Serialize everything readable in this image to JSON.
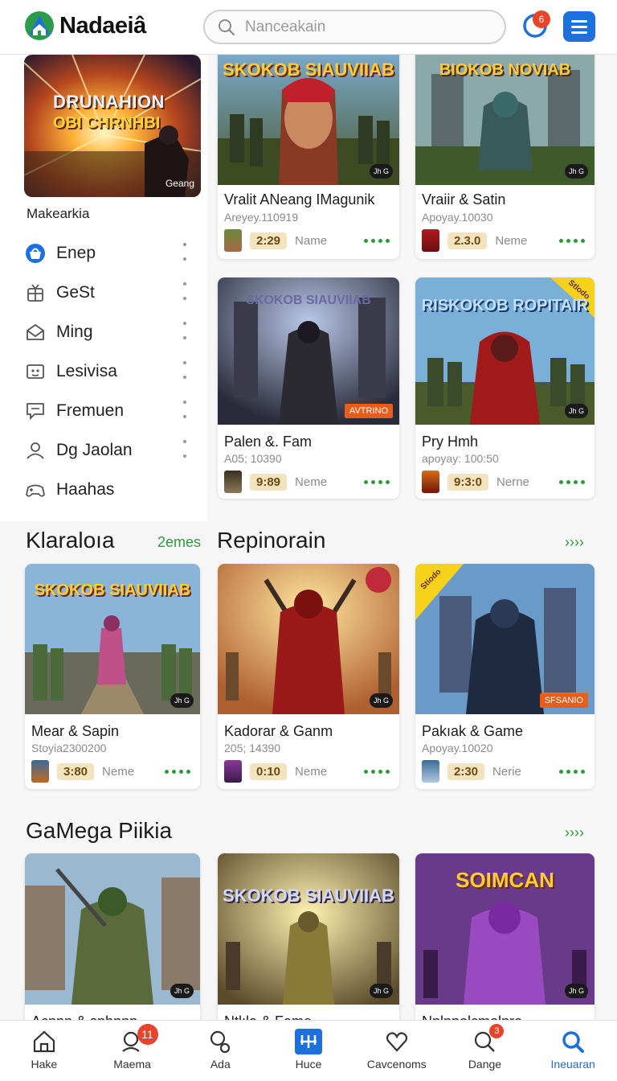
{
  "header": {
    "brand": "Nadaeiâ",
    "search_placeholder": "Nanceakain",
    "notification_count": "6"
  },
  "sidebar": {
    "feature_overlay_line1": "DRUNAHION",
    "feature_overlay_line2": "OBI CHRNHBI",
    "feature_tag": "Geang",
    "feature_title": "Makearkia",
    "items": [
      {
        "label": "Enep",
        "icon": "shopping-bag-icon"
      },
      {
        "label": "GeSt",
        "icon": "gift-box-icon"
      },
      {
        "label": "Ming",
        "icon": "mail-icon"
      },
      {
        "label": "Lesivisa",
        "icon": "picture-icon"
      },
      {
        "label": "Fremuen",
        "icon": "chat-icon"
      },
      {
        "label": "Dg Jaolan",
        "icon": "user-icon"
      },
      {
        "label": "Haahas",
        "icon": "gamepad-icon"
      }
    ]
  },
  "top_cards": [
    {
      "title": "Vralit ANeang IMagunik",
      "subtitle": "Areyey.110919",
      "pill": "2:29",
      "name": "Name",
      "art": "SKOKOB SIAUVIIAB",
      "tag": "Jh G"
    },
    {
      "title": "Vraiir & Satin",
      "subtitle": "Apoyay.10030",
      "pill": "2.3.0",
      "name": "Neme",
      "art": "BIOKOB NOVIAB",
      "tag": "Jh G"
    },
    {
      "title": "Palen &. Fam",
      "subtitle": "A05; 10390",
      "pill": "9:89",
      "name": "Neme",
      "art": "SKOKOB SIAUVIIAB",
      "ribbon": "AVTRINO"
    },
    {
      "title": "Pry Hmh",
      "subtitle": "apoyay: 100:50",
      "pill": "9:3:0",
      "name": "Nerne",
      "art": "RISKOKOB ROPITAIR",
      "corner": "Stlodo",
      "tag": "Jh G"
    }
  ],
  "sections": [
    {
      "title": "Klaraloıa",
      "link": "2emes"
    },
    {
      "title": "Repinorain",
      "link": "››››"
    },
    {
      "title": "GaMega Piikia",
      "link": "››››"
    }
  ],
  "mid_cards": [
    {
      "title": "Mear & Sapin",
      "subtitle": "Stoyia2300200",
      "pill": "3:80",
      "name": "Neme",
      "art": "SKOKOB SIAUVIIAB",
      "tag": "Jh G"
    },
    {
      "title": "Kadorar & Ganm",
      "subtitle": "205; 14390",
      "pill": "0:10",
      "name": "Neme",
      "art": "",
      "tag": "Jh G"
    },
    {
      "title": "Pakıak & Game",
      "subtitle": "Apoyay.10020",
      "pill": "2:30",
      "name": "Nerie",
      "art": "",
      "ribbon": "SFSANIO",
      "corner": "Stiodo"
    }
  ],
  "bottom_cards": [
    {
      "title": "Acnnn & snhnnn",
      "art": "",
      "tag": "Jh G"
    },
    {
      "title": "Ntlıla & Fame",
      "art": "SKOKOB SIAUVIIAB",
      "tag": "Jh G"
    },
    {
      "title": "Nnlnnolcmolnro",
      "art": "SOIMCAN",
      "tag": "Jh G"
    }
  ],
  "bottom_nav": {
    "items": [
      {
        "label": "Hake",
        "icon": "home-icon"
      },
      {
        "label": "Maema",
        "icon": "person-search-icon",
        "badge": "11"
      },
      {
        "label": "Ada",
        "icon": "search-key-icon"
      },
      {
        "label": "Huce",
        "icon": "grid-plus-icon"
      },
      {
        "label": "Cavcenoms",
        "icon": "heart-icon"
      },
      {
        "label": "Dange",
        "icon": "magnifier-icon",
        "badge": "3"
      },
      {
        "label": "Ineuaran",
        "icon": "search-icon"
      }
    ]
  },
  "colors": {
    "accent": "#1e6fe0",
    "green": "#2a9d3a",
    "badge": "#e8442a",
    "pill_bg": "#f4e3bf"
  }
}
